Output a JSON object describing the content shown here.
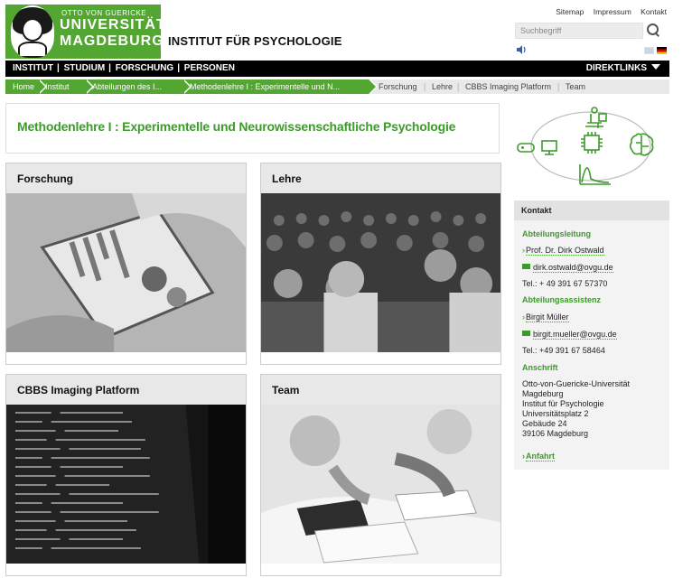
{
  "header": {
    "logo": {
      "line1": "OTTO VON GUERICKE",
      "line2": "UNIVERSITÄT",
      "line3": "MAGDEBURG"
    },
    "institute": "INSTITUT FÜR PSYCHOLOGIE",
    "toplinks": [
      "Sitemap",
      "Impressum",
      "Kontakt"
    ],
    "search_placeholder": "Suchbegriff"
  },
  "nav": {
    "items": [
      "INSTITUT",
      "STUDIUM",
      "FORSCHUNG",
      "PERSONEN"
    ],
    "separator": "|",
    "direktlinks": "DIREKTLINKS"
  },
  "breadcrumb": {
    "green": [
      "Home",
      "Institut",
      "Abteilungen des I...",
      "Methodenlehre I : Experimentelle und N..."
    ],
    "plain": [
      "Forschung",
      "Lehre",
      "CBBS Imaging Platform",
      "Team"
    ]
  },
  "page": {
    "title": "Methodenlehre I : Experimentelle und Neurowissenschaftliche Psychologie"
  },
  "cards": [
    {
      "title": "Forschung"
    },
    {
      "title": "Lehre"
    },
    {
      "title": "CBBS Imaging Platform"
    },
    {
      "title": "Team"
    }
  ],
  "kontakt": {
    "header": "Kontakt",
    "leitung_label": "Abteilungsleitung",
    "leitung_name": "Prof. Dr. Dirk Ostwald",
    "leitung_email": "dirk.ostwald@ovgu.de",
    "leitung_tel": "Tel.: + 49 391 67 57370",
    "assistenz_label": "Abteilungsassistenz",
    "assistenz_name": "Birgit Müller",
    "assistenz_email": "birgit.mueller@ovgu.de",
    "assistenz_tel": "Tel.: +49 391 67 58464",
    "anschrift_label": "Anschrift",
    "address": [
      "Otto-von-Guericke-Universität",
      "Magdeburg",
      "Institut für Psychologie",
      "Universitätsplatz 2",
      "Gebäude 24",
      "39106 Magdeburg"
    ],
    "anfahrt": "Anfahrt"
  },
  "colors": {
    "brand_green": "#54a633",
    "title_green": "#3d9a2b",
    "nav_black": "#000000"
  }
}
